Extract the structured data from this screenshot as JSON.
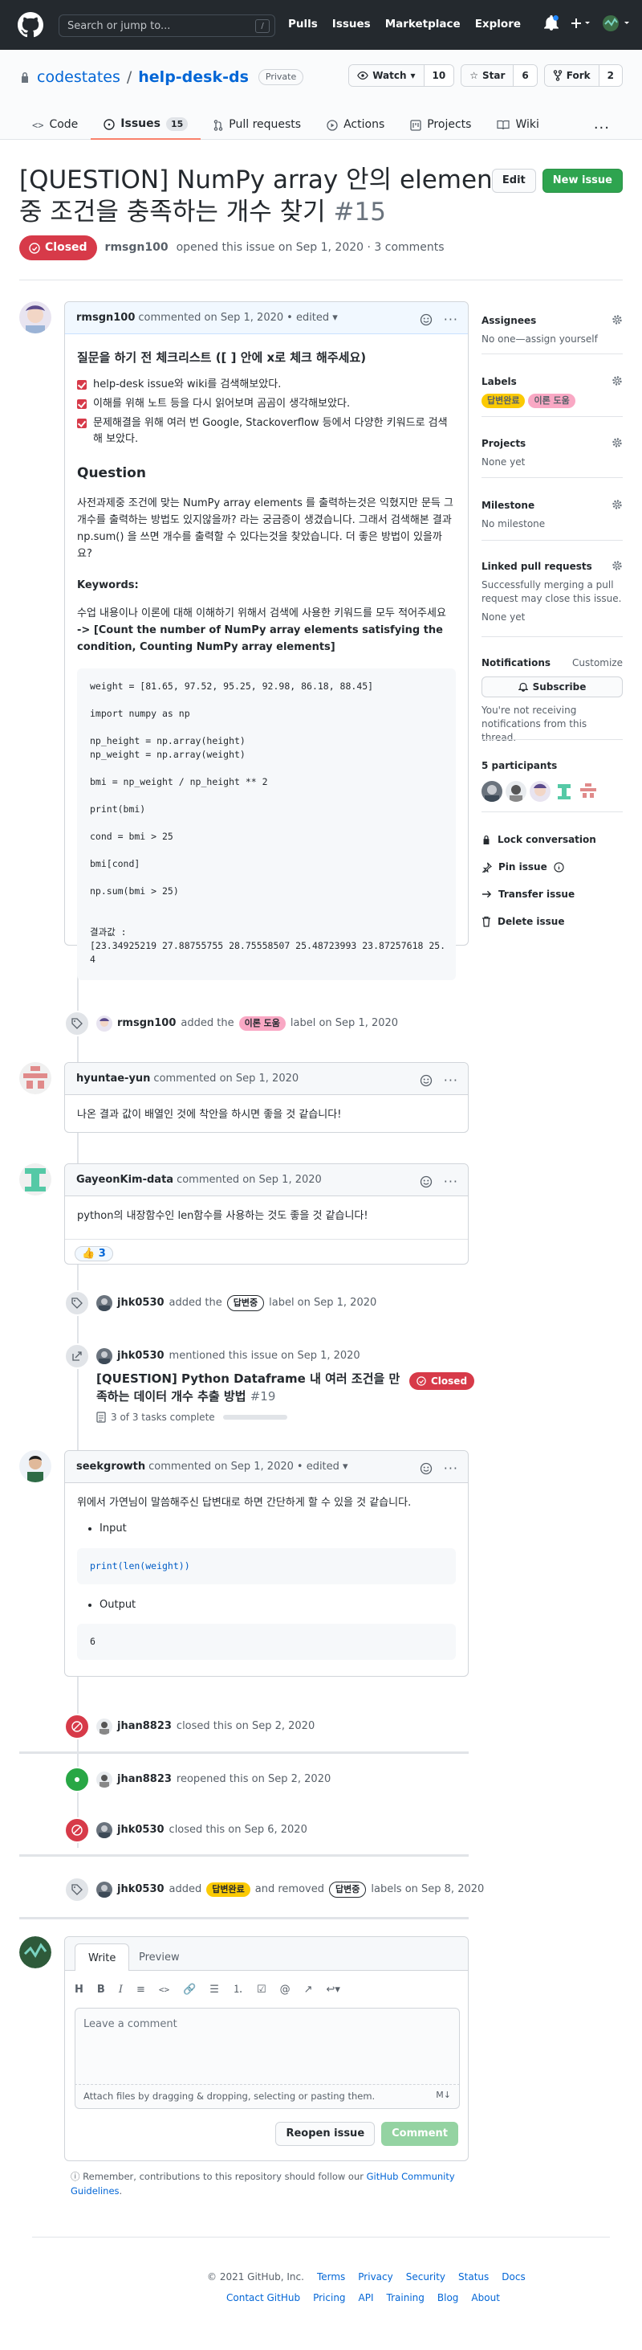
{
  "header": {
    "search_placeholder": "Search or jump to...",
    "search_hint": "/",
    "nav": [
      "Pulls",
      "Issues",
      "Marketplace",
      "Explore"
    ]
  },
  "repo": {
    "owner": "codestates",
    "separator": "/",
    "name": "help-desk-ds",
    "visibility": "Private",
    "watch_label": "Watch",
    "watch_count": "10",
    "star_label": "Star",
    "star_count": "6",
    "fork_label": "Fork",
    "fork_count": "2",
    "tabs": [
      {
        "label": "Code"
      },
      {
        "label": "Issues",
        "count": "15"
      },
      {
        "label": "Pull requests"
      },
      {
        "label": "Actions"
      },
      {
        "label": "Projects"
      },
      {
        "label": "Wiki"
      }
    ],
    "more": "···"
  },
  "issue": {
    "title": "[QUESTION] NumPy array 안의 elements 중 조건을 충족하는 개수 찾기",
    "number": "#15",
    "edit_label": "Edit",
    "new_issue_label": "New issue",
    "state": "Closed",
    "author": "rmsgn100",
    "meta": "opened this issue on Sep 1, 2020 · 3 comments"
  },
  "first_comment": {
    "user": "rmsgn100",
    "meta": "commented on Sep 1, 2020",
    "edited": "• edited ▾",
    "checklist_title": "질문을 하기 전 체크리스트 ([ ] 안에 x로 체크 해주세요)",
    "checklist": [
      "help-desk issue와 wiki를 검색해보았다.",
      "이해를 위해 노트 등을 다시 읽어보며 곰곰이 생각해보았다.",
      "문제해결을 위해 여러 번 Google, Stackoverflow 등에서 다양한 키워드로 검색해 보았다."
    ],
    "question_heading": "Question",
    "question_text": "사전과제중 조건에 맞는 NumPy array elements 를 출력하는것은 익혔지만 문득 그 개수를 출력하는 방법도 있지않을까? 라는 궁금증이 생겼습니다. 그래서 검색해본 결과 np.sum() 을 쓰면 개수를 출력할 수 있다는것을 찾았습니다. 더 좋은 방법이 있을까요?",
    "keywords_heading": "Keywords:",
    "keywords_text": "수업 내용이나 이론에 대해 이해하기 위해서 검색에 사용한 키워드를 모두 적어주세요",
    "keywords_bold": "-> [Count the number of NumPy array elements satisfying the condition, Counting NumPy array elements]",
    "code": "weight = [81.65, 97.52, 95.25, 92.98, 86.18, 88.45]\n\nimport numpy as np\n\nnp_height = np.array(height)\nnp_weight = np.array(weight)\n\nbmi = np_weight / np_height ** 2\n\nprint(bmi)\n\ncond = bmi > 25\n\nbmi[cond]\n\nnp.sum(bmi > 25)\n\n\n결과값 :\n[23.34925219 27.88755755 28.75558507 25.48723993 23.87257618 25.\n4"
  },
  "sidebar": {
    "assignees_h": "Assignees",
    "assignees_v": "No one—assign yourself",
    "labels_h": "Labels",
    "labels": [
      {
        "text": "답변완료",
        "bg": "#fbca04",
        "fg": "#24292e"
      },
      {
        "text": "이론 도움",
        "bg": "#f9a8c4",
        "fg": "#24292e"
      }
    ],
    "projects_h": "Projects",
    "projects_v": "None yet",
    "milestone_h": "Milestone",
    "milestone_v": "No milestone",
    "linked_h": "Linked pull requests",
    "linked_desc": "Successfully merging a pull request may close this issue.",
    "linked_v": "None yet",
    "notif_h": "Notifications",
    "notif_customize": "Customize",
    "subscribe": "Subscribe",
    "notif_desc": "You're not receiving notifications from this thread.",
    "participants_h": "5 participants",
    "lock": "Lock conversation",
    "pin": "Pin issue",
    "transfer": "Transfer issue",
    "delete": "Delete issue"
  },
  "events": {
    "label1_user": "rmsgn100",
    "label1_pre": "added the",
    "label1_label": "이론 도움",
    "label1_post": "label on Sep 1, 2020",
    "c2_user": "hyuntae-yun",
    "c2_meta": "commented on Sep 1, 2020",
    "c2_body": "나온 결과 값이 배열인 것에 착안을 하시면 좋을 것 같습니다!",
    "c3_user": "GayeonKim-data",
    "c3_meta": "commented on Sep 1, 2020",
    "c3_body": "python의 내장함수인 len함수를 사용하는 것도 좋을 것 같습니다!",
    "c3_reaction": "👍 3",
    "label2_user": "jhk0530",
    "label2_pre": "added the",
    "label2_label": "답변중",
    "label2_post": "label on Sep 1, 2020",
    "mention_user": "jhk0530",
    "mention_text": "mentioned this issue on Sep 1, 2020",
    "mention_title": "[QUESTION] Python Dataframe 내 여러 조건을 만족하는 데이터 개수 추출 방법",
    "mention_num": "#19",
    "mention_state": "Closed",
    "mention_tasks": "3 of 3 tasks complete",
    "c4_user": "seekgrowth",
    "c4_meta": "commented on Sep 1, 2020",
    "c4_edited": "• edited ▾",
    "c4_body": "위에서 가연님이 말씀해주신 답변대로 하면 간단하게 할 수 있을 것 같습니다.",
    "c4_input": "Input",
    "c4_code1": "print(len(weight))",
    "c4_output": "Output",
    "c4_code2": "6",
    "closed1_user": "jhan8823",
    "closed1_text": "closed this on Sep 2, 2020",
    "reopen_user": "jhan8823",
    "reopen_text": "reopened this on Sep 2, 2020",
    "closed2_user": "jhk0530",
    "closed2_text": "closed this on Sep 6, 2020",
    "label3_user": "jhk0530",
    "label3_pre": "added",
    "label3_added": "답변완료",
    "label3_mid": "and removed",
    "label3_removed": "답변중",
    "label3_post": "labels on Sep 8, 2020"
  },
  "compose": {
    "tab_write": "Write",
    "tab_preview": "Preview",
    "placeholder": "Leave a comment",
    "attach": "Attach files by dragging & dropping, selecting or pasting them.",
    "reopen": "Reopen issue",
    "comment": "Comment",
    "remember_pre": "Remember, contributions to this repository should follow our",
    "remember_link": "GitHub Community Guidelines",
    "remember_post": "."
  },
  "footer": {
    "copy": "© 2021 GitHub, Inc.",
    "row1": [
      "Terms",
      "Privacy",
      "Security",
      "Status",
      "Docs"
    ],
    "row2": [
      "Contact GitHub",
      "Pricing",
      "API",
      "Training",
      "Blog",
      "About"
    ]
  },
  "colors": {
    "closed_red": "#d73a49",
    "reopen_green": "#28a745",
    "link_blue": "#0366d6",
    "header_dark": "#24292e"
  }
}
